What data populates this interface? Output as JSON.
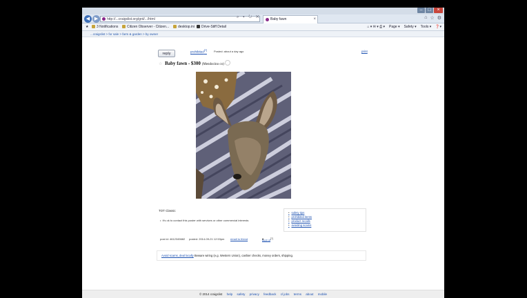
{
  "browser": {
    "url": "http://...craigslist.org/grd/.../html",
    "tab_title": "Baby fawn",
    "tab_close": "×",
    "window_controls": [
      "–",
      "□",
      "×"
    ],
    "address_icons": "⌕ ▾ ↻ ✕",
    "tool_icons": [
      "⌂",
      "☆",
      "⚙"
    ],
    "nav": {
      "back": "◀",
      "forward": "▶"
    }
  },
  "favorites": {
    "items": [
      "3 Notifications",
      "Citizen Observer - Citizen...",
      "desktop.ini",
      "Drive-Stiff Detail"
    ],
    "commands": [
      "Page ▾",
      "Safety ▾",
      "Tools ▾",
      "❓▾"
    ],
    "command_icons": "⌂ ▾ ✉ ▾ ⎙ ▾"
  },
  "breadcrumb": "...craigslist > for sale > farm & garden > by owner",
  "post": {
    "reply_label": "reply",
    "prohibited_label": "prohibited",
    "prohibited_sup": "[?]",
    "posted": "Posted: about a day ago",
    "print_label": "print",
    "star": "☆",
    "title": "Baby fawn - $300",
    "location": "(Mendocino co)",
    "body_text": "TOT Classic",
    "bullet": "it's ok to contact this poster with services or other commercial interests",
    "side_links": [
      "safety tips",
      "prohibited items",
      "product recalls",
      "avoiding scams"
    ],
    "post_id": "post id: 4612345682",
    "posted_date": "posted: 2014-09-21 12:53pm",
    "email_label": "email to friend",
    "best_of": "best of",
    "best_of_sup": "[?]",
    "safety_link": "Avoid scams, deal locally",
    "safety_text": "Beware wiring (e.g. Western Union), cashier checks, money orders, shipping."
  },
  "footer": {
    "copyright": "© 2014 craigslist",
    "links": [
      "help",
      "safety",
      "privacy",
      "feedback",
      "cl jobs",
      "terms",
      "about",
      "mobile"
    ]
  }
}
